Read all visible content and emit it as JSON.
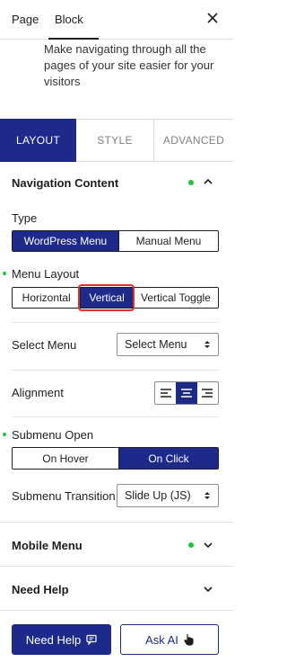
{
  "header": {
    "tab_page": "Page",
    "tab_block": "Block"
  },
  "description": "Make navigating through all the pages of your site easier for your visitors",
  "tabs": [
    "LAYOUT",
    "STYLE",
    "ADVANCED"
  ],
  "navigation_content": {
    "title": "Navigation Content",
    "type_label": "Type",
    "type_options": [
      "WordPress Menu",
      "Manual Menu"
    ],
    "menu_layout_label": "Menu Layout",
    "menu_layout_options": [
      "Horizontal",
      "Vertical",
      "Vertical Toggle"
    ],
    "select_menu_label": "Select Menu",
    "select_menu_value": "Select Menu",
    "alignment_label": "Alignment",
    "submenu_open_label": "Submenu Open",
    "submenu_open_options": [
      "On Hover",
      "On Click"
    ],
    "submenu_transition_label": "Submenu Transition",
    "submenu_transition_value": "Slide Up (JS)"
  },
  "mobile_menu": {
    "title": "Mobile Menu"
  },
  "need_help": {
    "title": "Need Help"
  },
  "footer": {
    "need_help_button": "Need Help",
    "ask_ai_button": "Ask AI"
  },
  "colors": {
    "accent": "#1e2a8a",
    "dot": "#1ec63a",
    "highlight": "#e03131"
  }
}
